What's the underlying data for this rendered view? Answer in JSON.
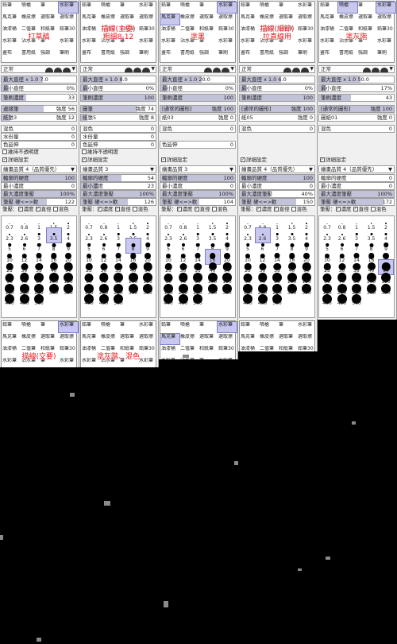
{
  "tools": [
    [
      "鉛筆",
      "噴槍",
      "筆",
      "水彩筆"
    ],
    [
      "馬克筆",
      "橡皮擦",
      "選取筆",
      "選取擦"
    ],
    [
      "油漆桶",
      "二值筆",
      "和紙筆",
      "鉛筆30"
    ],
    [
      "水彩筆",
      "沾水筆",
      "筆",
      "水彩筆"
    ],
    [
      "畫布",
      "書用紙",
      "強調",
      "筆刷"
    ]
  ],
  "panels": [
    {
      "label": "打草稿",
      "mode": "正常",
      "max_size": "x 1.0   7.0",
      "min_size": "0%",
      "density": "33",
      "shape": "邊緣筆",
      "shape_val": "56",
      "texture": "紙張3",
      "texture_val": "12",
      "blend": "0",
      "dilution": "0",
      "persist": "0",
      "keep_opacity": "維持不透明度",
      "detail": "詳細設定",
      "quality": "4（品質優先）",
      "edge": "100",
      "min_density": "0",
      "max_pressure": "100%",
      "hard_soft": "122",
      "dots": [
        "0.7",
        "0.8",
        "1",
        "1.5",
        "2",
        "2.3",
        "2.6",
        "3",
        "3.5",
        "4",
        "5",
        "6",
        "7",
        "8",
        "9",
        "10",
        "12",
        "14",
        "16",
        "20",
        "25",
        "30",
        "35",
        "40",
        "50",
        "60",
        "70",
        "80",
        "100",
        "120",
        "160",
        "200",
        "250",
        "300",
        "350",
        "400",
        "450",
        "500"
      ]
    },
    {
      "label": "描線(主要)\n粗細8-12",
      "mode": "正常",
      "max_size": "x 1.0   8.0",
      "min_size": "0%",
      "density": "100",
      "shape": "圖筆",
      "shape_val": "74",
      "texture": "紙張5",
      "texture_val": "8",
      "blend": "0",
      "dilution": "0",
      "persist": "0",
      "keep_opacity": "維持不透明度",
      "detail": "詳細設定",
      "quality": "3",
      "edge": "54",
      "min_density": "23",
      "max_pressure": "100%",
      "hard_soft": "126",
      "dots": [
        "0.7",
        "0.8",
        "1",
        "1.5",
        "2",
        "2.3",
        "2.6",
        "3",
        "3.5",
        "4",
        "5",
        "6",
        "7",
        "8",
        "9",
        "10",
        "12",
        "14",
        "16",
        "20",
        "25",
        "30",
        "35",
        "40",
        "50",
        "60",
        "70",
        "80",
        "100",
        "120",
        "160",
        "200",
        "250",
        "300",
        "350",
        "400",
        "450",
        "500"
      ]
    },
    {
      "label": "塗黑",
      "mode": "正常",
      "max_size": "x 1.0   20.0",
      "min_size": "0%",
      "density": "100",
      "shape": "[通常的圖形]",
      "shape_val": "100",
      "texture": "紙03",
      "texture_val": "0",
      "blend": "0",
      "dilution": "",
      "persist": "0",
      "keep_opacity": "",
      "detail": "詳細設定",
      "quality": "3",
      "edge": "100",
      "min_density": "0",
      "max_pressure": "100%",
      "hard_soft": "104",
      "dots": [
        "0.7",
        "0.8",
        "1",
        "1.5",
        "2",
        "2.3",
        "2.6",
        "3",
        "3.5",
        "4",
        "5",
        "6",
        "7",
        "8",
        "9",
        "10",
        "12",
        "14",
        "16",
        "20",
        "25",
        "30",
        "35",
        "40",
        "50",
        "60",
        "70",
        "80",
        "100",
        "120",
        "160",
        "200",
        "250",
        "300",
        "350",
        "400",
        "450",
        "500"
      ]
    },
    {
      "label": "描線(細節)\n拉直線用",
      "mode": "正常",
      "max_size": "x 1.0   6.0",
      "min_size": "0%",
      "density": "100",
      "shape": "[通常的圖形]",
      "shape_val": "100",
      "texture": "紙05",
      "texture_val": "0",
      "blend": "0",
      "dilution": "",
      "persist": "",
      "keep_opacity": "",
      "detail": "詳細設定",
      "quality": "4（品質優先）",
      "edge": "100",
      "min_density": "0",
      "max_pressure": "40%",
      "hard_soft": "150",
      "dots": [
        "0.7",
        "0.8",
        "1",
        "1.5",
        "2",
        "2.3",
        "2.6",
        "3",
        "3.5",
        "4",
        "5",
        "6",
        "7",
        "8",
        "9",
        "10",
        "12",
        "14",
        "16",
        "20",
        "25",
        "30",
        "35",
        "40",
        "50",
        "60",
        "70",
        "80",
        "100",
        "120",
        "160",
        "200",
        "250",
        "300",
        "350",
        "400",
        "450",
        "500"
      ]
    },
    {
      "label": "塗灰階",
      "mode": "正常",
      "max_size": "x 1.0   50.0",
      "min_size": "17%",
      "density": "43",
      "shape": "[通常的圖形]",
      "shape_val": "100",
      "texture": "圖紙01",
      "texture_val": "0",
      "blend": "0",
      "dilution": "",
      "persist": "",
      "keep_opacity": "",
      "detail": "詳細設定",
      "quality": "4（品質優先）",
      "edge": "0",
      "min_density": "0",
      "max_pressure": "100%",
      "hard_soft": "172",
      "dots": [
        "0.7",
        "0.8",
        "1",
        "1.5",
        "2",
        "2.3",
        "2.6",
        "3",
        "3.5",
        "4",
        "5",
        "6",
        "7",
        "8",
        "9",
        "10",
        "12",
        "14",
        "16",
        "20",
        "25",
        "30",
        "35",
        "40",
        "50",
        "60",
        "70",
        "80",
        "100",
        "120",
        "160",
        "200",
        "250",
        "300",
        "350",
        "400",
        "450",
        "500"
      ]
    }
  ],
  "labels": {
    "mode_label": "正常",
    "max_size_label": "最大直徑",
    "min_size_label": "最小直徑",
    "density_label": "筆刷濃度",
    "blend_label": "混色",
    "dilution_label": "水份量",
    "persist_label": "色延伸",
    "quality_label": "繪畫品質",
    "edge_label": "輪廓的硬度",
    "min_density_label": "最小濃度",
    "max_pressure_label": "最大濃度筆壓",
    "hard_soft_label": "筆壓 硬<=>軟",
    "pressure_label": "筆壓：",
    "pr_density": "濃度",
    "pr_size": "直徑",
    "pr_blend": "混色",
    "strength": "強度"
  },
  "bottom_labels": [
    "描線(交要)",
    "塗灰階、混色",
    ""
  ],
  "colors": {
    "accent": "#e8161a",
    "selection": "#c8c8ee",
    "fill": "#c2c2d8"
  }
}
